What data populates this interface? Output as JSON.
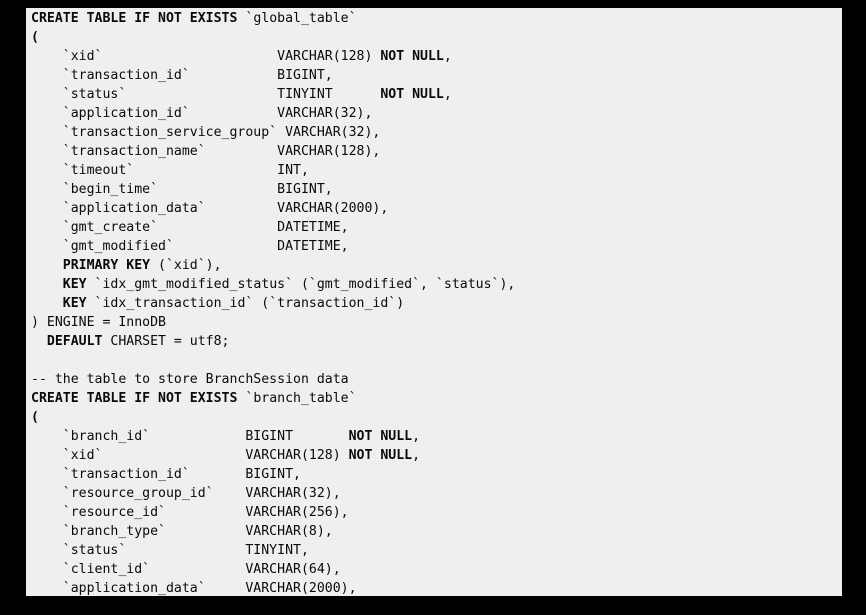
{
  "code_lines": [
    [
      {
        "t": "CREATE TABLE IF NOT EXISTS",
        "b": true
      },
      {
        "t": " `global_table`"
      }
    ],
    [
      {
        "t": "(",
        "b": true
      }
    ],
    [
      {
        "t": "    `xid`                      VARCHAR(128) "
      },
      {
        "t": "NOT NULL",
        "b": true
      },
      {
        "t": ","
      }
    ],
    [
      {
        "t": "    `transaction_id`           BIGINT,"
      }
    ],
    [
      {
        "t": "    `status`                   TINYINT      "
      },
      {
        "t": "NOT NULL",
        "b": true
      },
      {
        "t": ","
      }
    ],
    [
      {
        "t": "    `application_id`           VARCHAR(32),"
      }
    ],
    [
      {
        "t": "    `transaction_service_group` VARCHAR(32),"
      }
    ],
    [
      {
        "t": "    `transaction_name`         VARCHAR(128),"
      }
    ],
    [
      {
        "t": "    `timeout`                  INT,"
      }
    ],
    [
      {
        "t": "    `begin_time`               BIGINT,"
      }
    ],
    [
      {
        "t": "    `application_data`         VARCHAR(2000),"
      }
    ],
    [
      {
        "t": "    `gmt_create`               DATETIME,"
      }
    ],
    [
      {
        "t": "    `gmt_modified`             DATETIME,"
      }
    ],
    [
      {
        "t": "    "
      },
      {
        "t": "PRIMARY KEY",
        "b": true
      },
      {
        "t": " (`xid`),"
      }
    ],
    [
      {
        "t": "    "
      },
      {
        "t": "KEY",
        "b": true
      },
      {
        "t": " `idx_gmt_modified_status` (`gmt_modified`, `status`),"
      }
    ],
    [
      {
        "t": "    "
      },
      {
        "t": "KEY",
        "b": true
      },
      {
        "t": " `idx_transaction_id` (`transaction_id`)"
      }
    ],
    [
      {
        "t": ") ENGINE = InnoDB"
      }
    ],
    [
      {
        "t": "  "
      },
      {
        "t": "DEFAULT",
        "b": true
      },
      {
        "t": " CHARSET = utf8;"
      }
    ],
    [
      {
        "t": ""
      }
    ],
    [
      {
        "t": "-- the table to store BranchSession data"
      }
    ],
    [
      {
        "t": "CREATE TABLE IF NOT EXISTS",
        "b": true
      },
      {
        "t": " `branch_table`"
      }
    ],
    [
      {
        "t": "(",
        "b": true
      }
    ],
    [
      {
        "t": "    `branch_id`            BIGINT       "
      },
      {
        "t": "NOT NULL",
        "b": true
      },
      {
        "t": ","
      }
    ],
    [
      {
        "t": "    `xid`                  VARCHAR(128) "
      },
      {
        "t": "NOT NULL",
        "b": true
      },
      {
        "t": ","
      }
    ],
    [
      {
        "t": "    `transaction_id`       BIGINT,"
      }
    ],
    [
      {
        "t": "    `resource_group_id`    VARCHAR(32),"
      }
    ],
    [
      {
        "t": "    `resource_id`          VARCHAR(256),"
      }
    ],
    [
      {
        "t": "    `branch_type`          VARCHAR(8),"
      }
    ],
    [
      {
        "t": "    `status`               TINYINT,"
      }
    ],
    [
      {
        "t": "    `client_id`            VARCHAR(64),"
      }
    ],
    [
      {
        "t": "    `application_data`     VARCHAR(2000),"
      }
    ]
  ],
  "colors": {
    "background": "#000000",
    "code_panel": "#efefef",
    "text": "#0a0a0a"
  }
}
